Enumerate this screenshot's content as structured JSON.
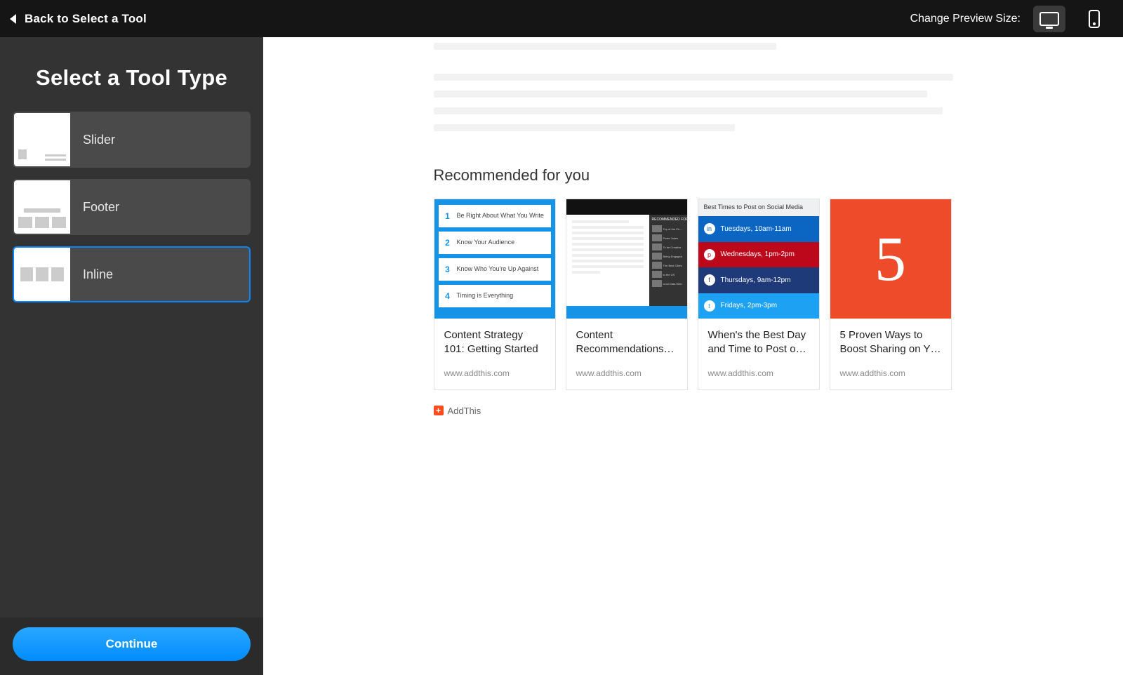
{
  "topbar": {
    "back_label": "Back to Select a Tool",
    "preview_label": "Change Preview Size:"
  },
  "sidebar": {
    "title": "Select a Tool Type",
    "tools": [
      {
        "label": "Slider"
      },
      {
        "label": "Footer"
      },
      {
        "label": "Inline"
      }
    ],
    "continue_label": "Continue"
  },
  "preview": {
    "recommended_heading": "Recommended for you",
    "cards": [
      {
        "title": "Content Strategy 101: Getting Started",
        "source": "www.addthis.com",
        "items": [
          {
            "n": "1",
            "t": "Be Right About What You Write"
          },
          {
            "n": "2",
            "t": "Know Your Audience"
          },
          {
            "n": "3",
            "t": "Know Who You're Up Against"
          },
          {
            "n": "4",
            "t": "Timing is Everything"
          }
        ]
      },
      {
        "title": "Content Recommendations…",
        "source": "www.addthis.com",
        "side_heading": "RECOMMENDED FOR YOU"
      },
      {
        "title": "When's the Best Day and Time to Post o…",
        "source": "www.addthis.com",
        "head": "Best Times to Post on Social Media",
        "rows": [
          {
            "net": "in",
            "text": "Tuesdays, 10am-11am"
          },
          {
            "net": "p",
            "text": "Wednesdays, 1pm-2pm"
          },
          {
            "net": "f",
            "text": "Thursdays, 9am-12pm"
          },
          {
            "net": "t",
            "text": "Fridays, 2pm-3pm"
          }
        ]
      },
      {
        "title": "5 Proven Ways to Boost Sharing on Y…",
        "source": "www.addthis.com",
        "big": "5"
      }
    ],
    "addthis_label": "AddThis"
  }
}
